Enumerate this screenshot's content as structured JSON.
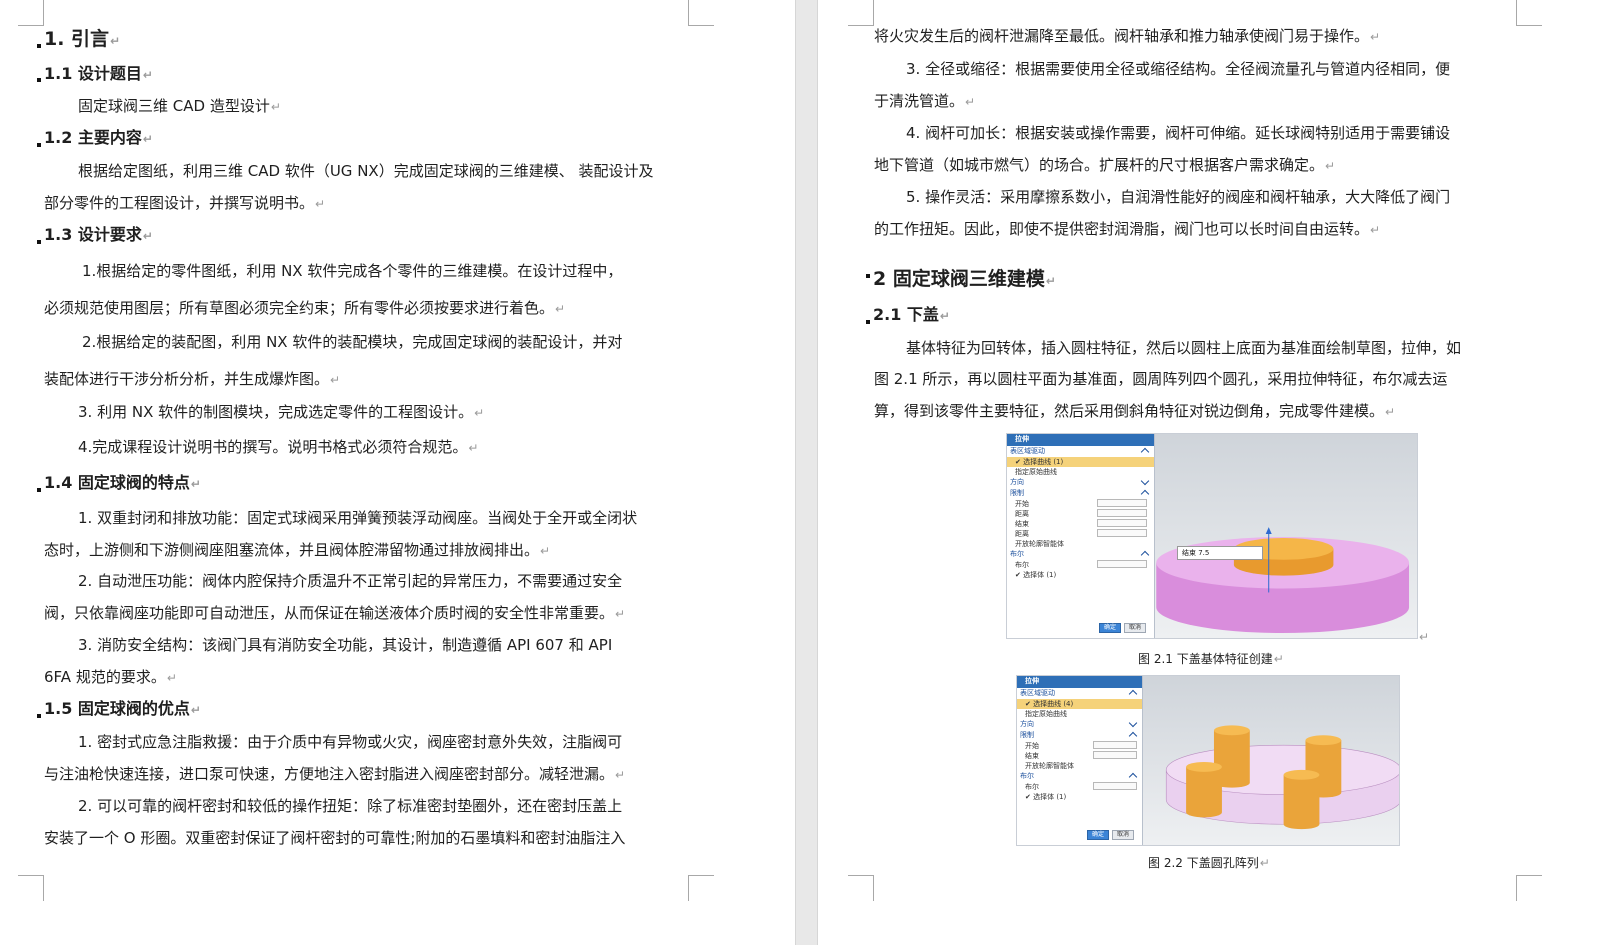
{
  "pm": "↵",
  "left_page": {
    "h1_intro": "1. 引言",
    "h2_1": "1.1 设计题目",
    "p_topic": "固定球阀三维 CAD 造型设计",
    "h2_2": "1.2 主要内容",
    "p_content_1": "根据给定图纸，利用三维 CAD 软件（UG NX）完成固定球阀的三维建模、 装配设计及",
    "p_content_2": "部分零件的工程图设计，并撰写说明书。",
    "h2_3": "1.3 设计要求",
    "req1_a": "1.根据给定的零件图纸，利用 NX 软件完成各个零件的三维建模。在设计过程中，",
    "req1_b": "必须规范使用图层；所有草图必须完全约束；所有零件必须按要求进行着色。",
    "req2_a": "2.根据给定的装配图，利用 NX 软件的装配模块，完成固定球阀的装配设计，并对",
    "req2_b": "装配体进行干涉分析分析，并生成爆炸图。",
    "req3": "3. 利用 NX 软件的制图模块，完成选定零件的工程图设计。",
    "req4": "4.完成课程设计说明书的撰写。说明书格式必须符合规范。",
    "h2_4": "1.4 固定球阀的特点",
    "f1_a": "1. 双重封闭和排放功能：固定式球阀采用弹簧预装浮动阀座。当阀处于全开或全闭状",
    "f1_b": "态时，上游侧和下游侧阀座阻塞流体，并且阀体腔滞留物通过排放阀排出。",
    "f2_a": "2. 自动泄压功能：阀体内腔保持介质温升不正常引起的异常压力，不需要通过安全",
    "f2_b": "阀，只依靠阀座功能即可自动泄压，从而保证在输送液体介质时阀的安全性非常重要。",
    "f3_a": "3. 消防安全结构：该阀门具有消防安全功能，其设计，制造遵循 API 607 和 API",
    "f3_b": "6FA 规范的要求。",
    "h2_5": "1.5 固定球阀的优点",
    "a1_a": "1. 密封式应急注脂救援：由于介质中有异物或火灾，阀座密封意外失效，注脂阀可",
    "a1_b": "与注油枪快速连接，进口泵可快速，方便地注入密封脂进入阀座密封部分。减轻泄漏。",
    "a2_a": "2. 可以可靠的阀杆密封和较低的操作扭矩：除了标准密封垫圈外，还在密封压盖上",
    "a2_b": "安装了一个 O 形圈。双重密封保证了阀杆密封的可靠性;附加的石墨填料和密封油脂注入"
  },
  "right_page": {
    "p_cont": "将火灾发生后的阀杆泄漏降至最低。阀杆轴承和推力轴承使阀门易于操作。",
    "p3_a": "3. 全径或缩径：根据需要使用全径或缩径结构。全径阀流量孔与管道内径相同，便",
    "p3_b": "于清洗管道。",
    "p4_a": "4. 阀杆可加长：根据安装或操作需要，阀杆可伸缩。延长球阀特别适用于需要铺设",
    "p4_b": "地下管道（如城市燃气）的场合。扩展杆的尺寸根据客户需求确定。",
    "p5_a": "5. 操作灵活：采用摩擦系数小，自润滑性能好的阀座和阀杆轴承，大大降低了阀门",
    "p5_b": "的工作扭矩。因此，即使不提供密封润滑脂，阀门也可以长时间自由运转。",
    "h1_model": "2 固定球阀三维建模",
    "h2_cover": "2.1 下盖",
    "c_a": "基体特征为回转体，插入圆柱特征，然后以圆柱上底面为基准面绘制草图，拉伸，如",
    "c_b": "图 2.1 所示，再以圆柱平面为基准面，圆周阵列四个圆孔，采用拉伸特征，布尔减去运",
    "c_c": "算，得到该零件主要特征，然后采用倒斜角特征对锐边倒角，完成零件建模。",
    "fig1_caption": "图 2.1 下盖基体特征创建",
    "fig2_caption": "图 2.2 下盖圆孔阵列"
  },
  "fig1_panel": {
    "title": "拉伸",
    "sec_section": "表区域驱动",
    "row_curve": "✔ 选择曲线 (1)",
    "row_sketch": "指定原始曲线",
    "sec_dir": "方向",
    "sec_limit": "限制",
    "row_start": "开始",
    "row_dist1": "距离",
    "row_end": "结束",
    "row_dist2": "距离",
    "row_open": "开放轮廓智能体",
    "sec_bool": "布尔",
    "row_bool": "布尔",
    "row_body": "✔ 选择体 (1)",
    "btn_ok": "确定",
    "btn_cancel": "取消",
    "tip_label": "结束 7.5"
  },
  "fig2_panel": {
    "title": "拉伸",
    "sec_section": "表区域驱动",
    "row_curve": "✔ 选择曲线 (4)",
    "row_sketch": "指定原始曲线",
    "sec_dir": "方向",
    "sec_limit": "限制",
    "row_start": "开始",
    "row_end": "结束",
    "row_open": "开放轮廓智能体",
    "sec_bool": "布尔",
    "row_bool": "布尔",
    "row_body": "✔ 选择体 (1)",
    "btn_ok": "确定",
    "btn_cancel": "取消"
  },
  "colors": {
    "pink": "#e59be8",
    "orange": "#f2a93b",
    "viewport": "#dde1e6",
    "dialog_title": "#2e6fb7"
  }
}
